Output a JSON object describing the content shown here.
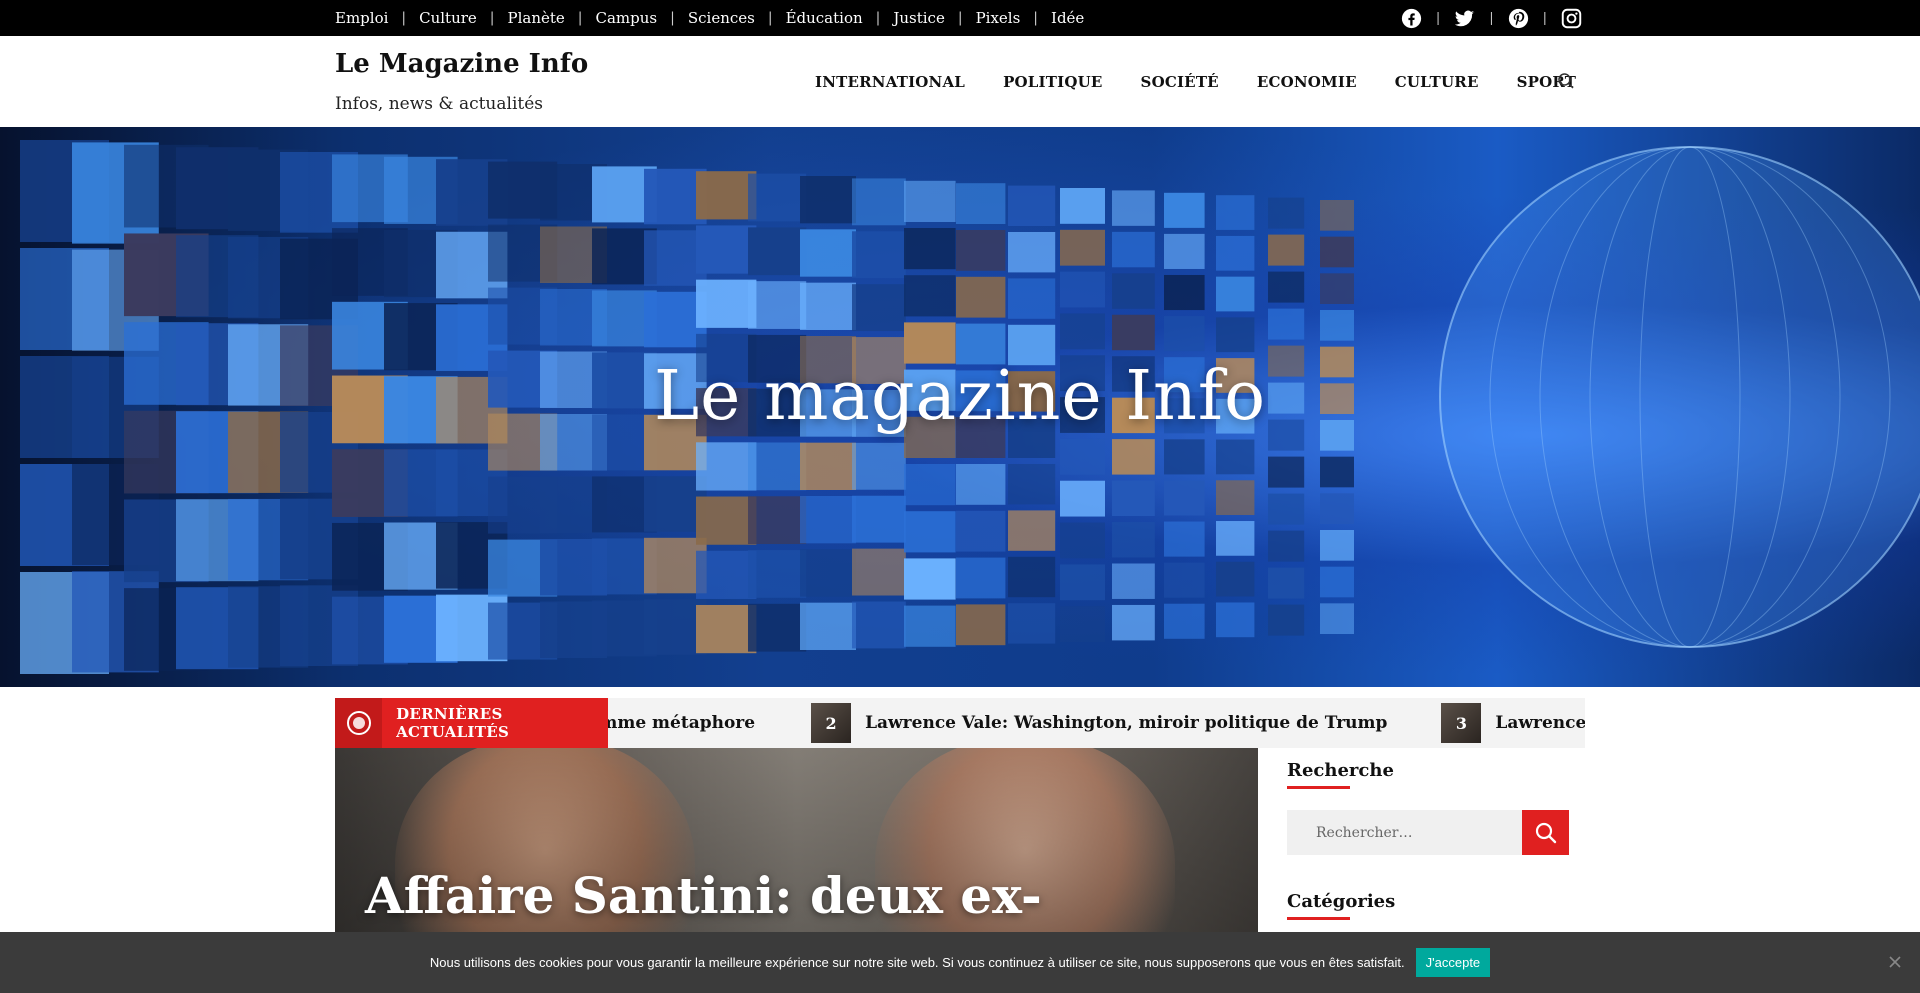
{
  "topbar": {
    "links": [
      "Emploi",
      "Culture",
      "Planète",
      "Campus",
      "Sciences",
      "Éducation",
      "Justice",
      "Pixels",
      "Idée"
    ],
    "social": [
      "facebook-icon",
      "twitter-icon",
      "pinterest-icon",
      "instagram-icon"
    ],
    "separator": "|"
  },
  "header": {
    "title": "Le Magazine Info",
    "tagline": "Infos, news & actualités",
    "nav": [
      "INTERNATIONAL",
      "POLITIQUE",
      "SOCIÉTÉ",
      "ECONOMIE",
      "CULTURE",
      "SPORT"
    ],
    "search_icon": "search-icon"
  },
  "hero": {
    "title": "Le magazine Info"
  },
  "ticker": {
    "label": "DERNIÈRES ACTUALITÉS",
    "items": [
      {
        "text": "omme métaphore"
      },
      {
        "num": "2",
        "text": "Lawrence Vale: Washington, miroir politique de Trump"
      },
      {
        "num": "3",
        "text": "Lawrence Vale: Washingto"
      }
    ]
  },
  "featured": {
    "title": "Affaire Santini: deux ex-"
  },
  "sidebar": {
    "search_heading": "Recherche",
    "search_placeholder": "Rechercher…",
    "categories_heading": "Catégories"
  },
  "cookie": {
    "message": "Nous utilisons des cookies pour vous garantir la meilleure expérience sur notre site web. Si vous continuez à utiliser ce site, nous supposerons que vous en êtes satisfait.",
    "accept": "J'accepte",
    "close_icon": "close-icon"
  },
  "colors": {
    "accent": "#e02020",
    "topbar_bg": "#000000",
    "cookie_bg": "#3b3b3b",
    "cookie_button": "#00a99d"
  }
}
